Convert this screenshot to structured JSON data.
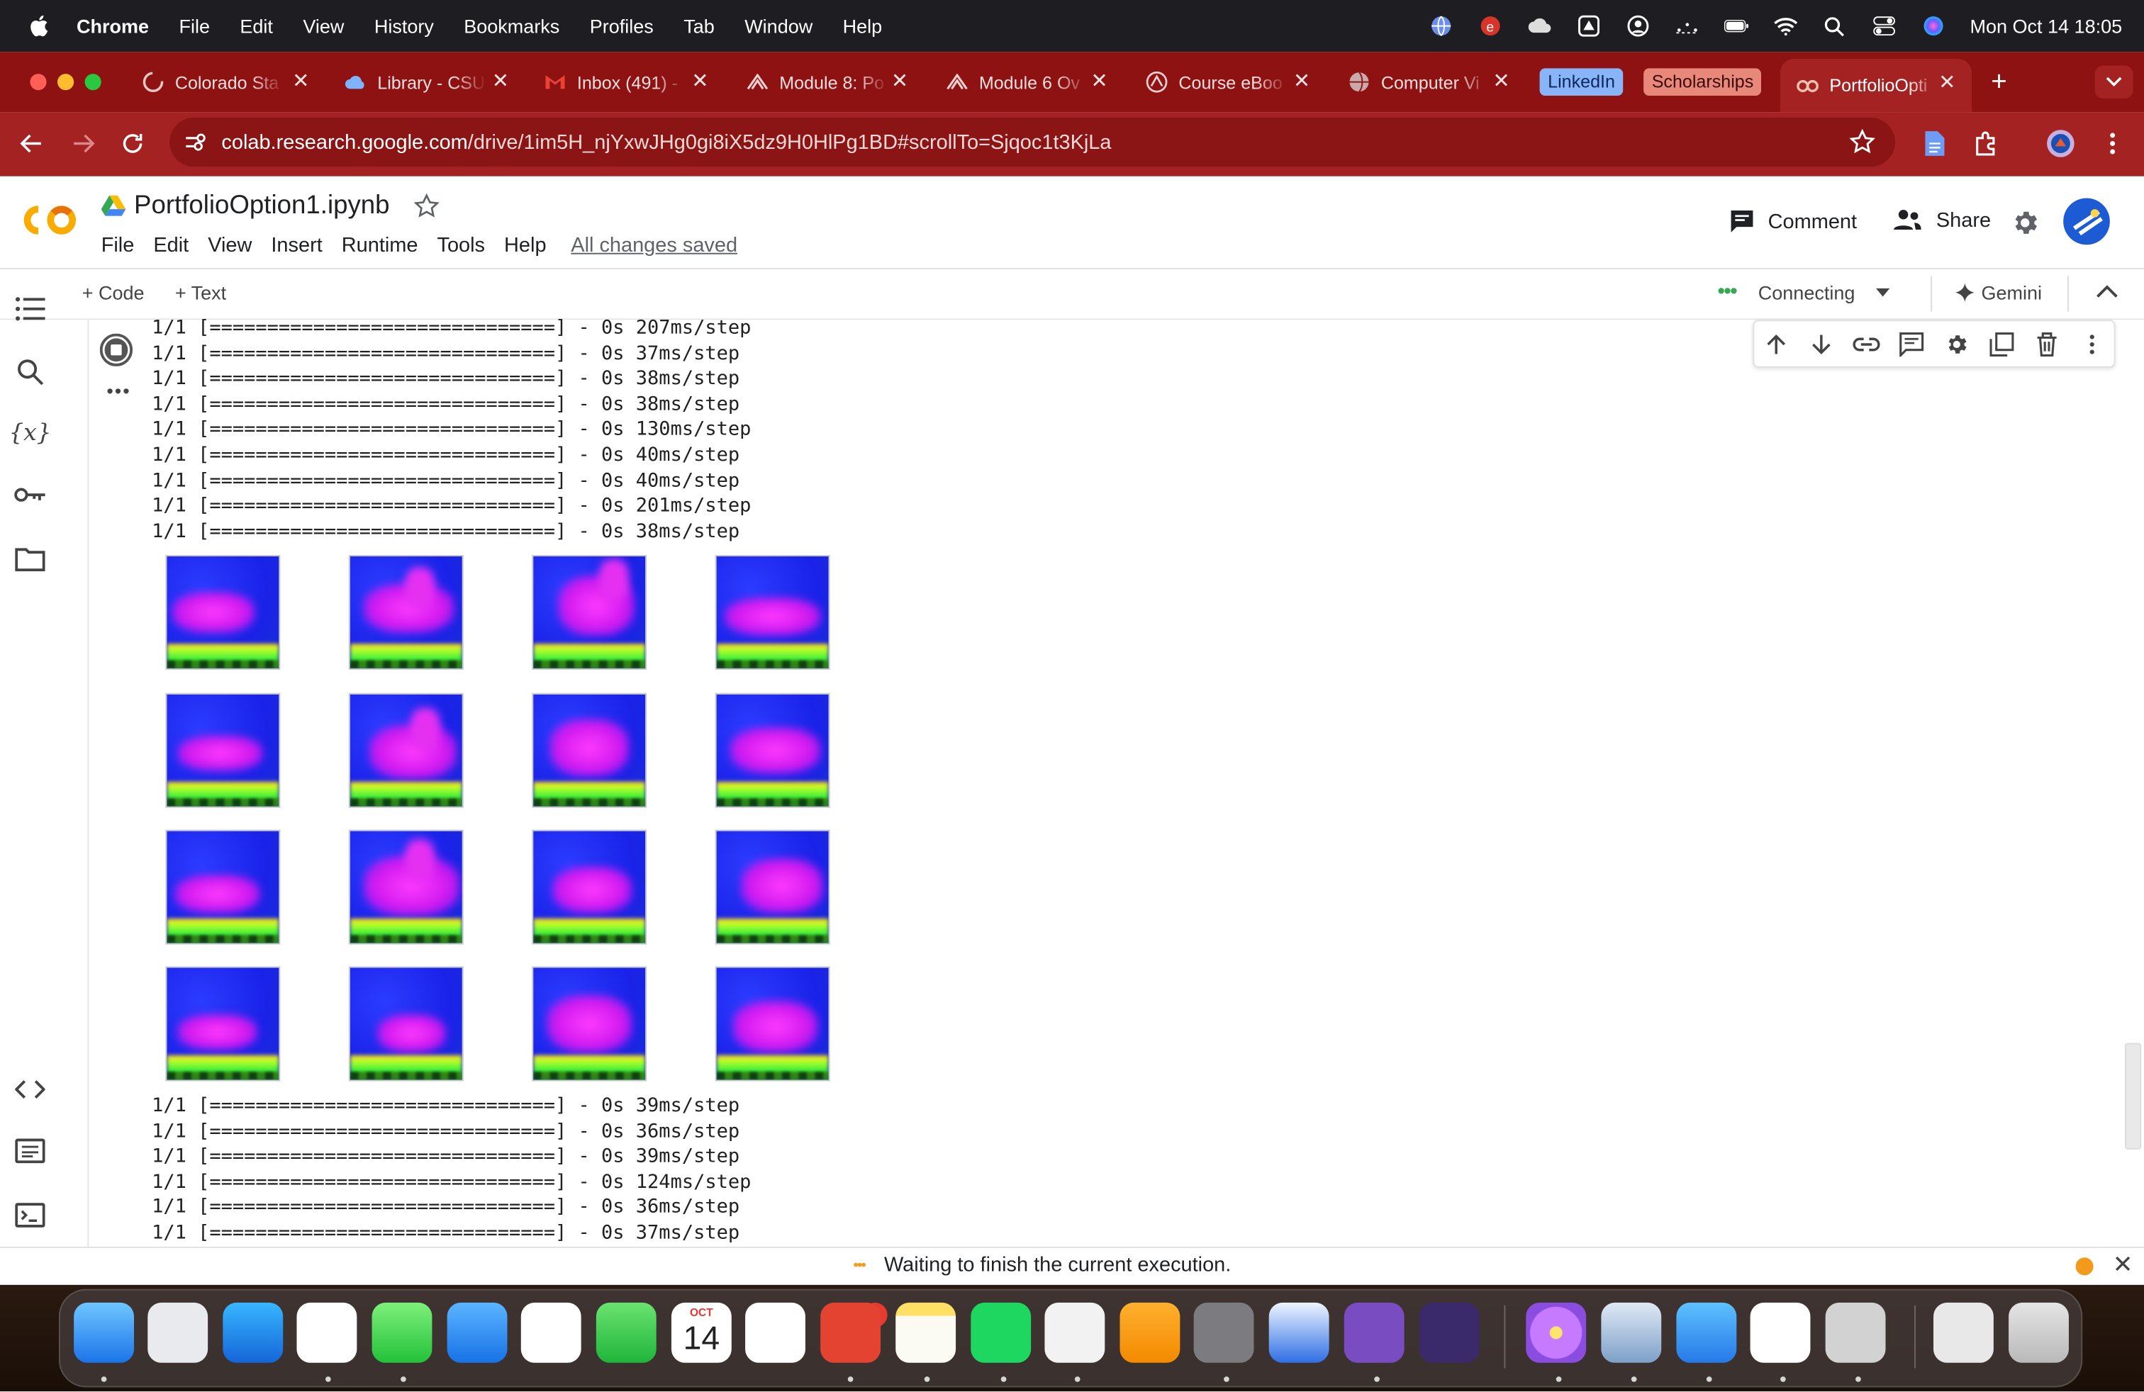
{
  "menubar": {
    "app": "Chrome",
    "items": [
      "File",
      "Edit",
      "View",
      "History",
      "Bookmarks",
      "Profiles",
      "Tab",
      "Window",
      "Help"
    ],
    "clock": "Mon Oct 14  18:05"
  },
  "tabs": [
    {
      "label": "Colorado Sta",
      "icon": "loading-icon"
    },
    {
      "label": "Library - CSU",
      "icon": "cloud-icon"
    },
    {
      "label": "Inbox (491) -",
      "icon": "gmail-icon"
    },
    {
      "label": "Module 8: Po",
      "icon": "canvas-icon"
    },
    {
      "label": "Module 6 Ov",
      "icon": "canvas-icon"
    },
    {
      "label": "Course eBoo",
      "icon": "canvas-icon"
    },
    {
      "label": "Computer Vi",
      "icon": "globe-icon"
    },
    {
      "label": "PortfolioOpti",
      "icon": "colab-icon",
      "active": true
    }
  ],
  "pill_tabs": [
    {
      "label": "LinkedIn",
      "bg": "#8ab4f8",
      "fg": "#0b2a5c"
    },
    {
      "label": "Scholarships",
      "bg": "#e8887b",
      "fg": "#3b0a05"
    }
  ],
  "address": {
    "host": "colab.research.google.com",
    "path": "/drive/1im5H_njYxwJHg0gi8iX5dz9H0HlPg1BD#scrollTo=Sjqoc1t3KjLa"
  },
  "notebook": {
    "title": "PortfolioOption1.ipynb",
    "menu": [
      "File",
      "Edit",
      "View",
      "Insert",
      "Runtime",
      "Tools",
      "Help"
    ],
    "saved": "All changes saved",
    "comment": "Comment",
    "share": "Share"
  },
  "cellbar": {
    "add_code": "+ Code",
    "add_text": "+ Text",
    "runtime": "Connecting",
    "gemini": "Gemini"
  },
  "output": {
    "lines_top": [
      "1/1 [==============================] - 0s 207ms/step",
      "1/1 [==============================] - 0s 37ms/step",
      "1/1 [==============================] - 0s 38ms/step",
      "1/1 [==============================] - 0s 38ms/step",
      "1/1 [==============================] - 0s 130ms/step",
      "1/1 [==============================] - 0s 40ms/step",
      "1/1 [==============================] - 0s 40ms/step",
      "1/1 [==============================] - 0s 201ms/step",
      "1/1 [==============================] - 0s 38ms/step"
    ],
    "lines_bottom": [
      "1/1 [==============================] - 0s 39ms/step",
      "1/1 [==============================] - 0s 36ms/step",
      "1/1 [==============================] - 0s 39ms/step",
      "1/1 [==============================] - 0s 124ms/step",
      "1/1 [==============================] - 0s 36ms/step",
      "1/1 [==============================] - 0s 37ms/step"
    ],
    "image_grid": {
      "rows": 4,
      "cols": 4
    }
  },
  "status": {
    "text": "Waiting to finish the current execution.",
    "indicator_color": "#f29a1a"
  },
  "dock": {
    "apps": [
      "Finder",
      "Launchpad",
      "Safari",
      "Chrome",
      "Messages",
      "Mail",
      "Photos",
      "FaceTime",
      "Calendar",
      "Reminders",
      "Todoist",
      "Notes",
      "Spotify",
      "Preview",
      "Pages",
      "System Settings",
      "Word",
      "GitHub Desktop",
      "Obsidian",
      "Daisy",
      "Preview Photos",
      "Xcode",
      "VS Code",
      "Zotero",
      "Downloads",
      "Trash"
    ],
    "calendar_month": "OCT",
    "calendar_day": "14",
    "todoist_badge": "7"
  },
  "colors": {
    "chrome_frame": "#8e1212",
    "chrome_toolbar": "#a52222",
    "colab_orange": "#f9ab00"
  }
}
